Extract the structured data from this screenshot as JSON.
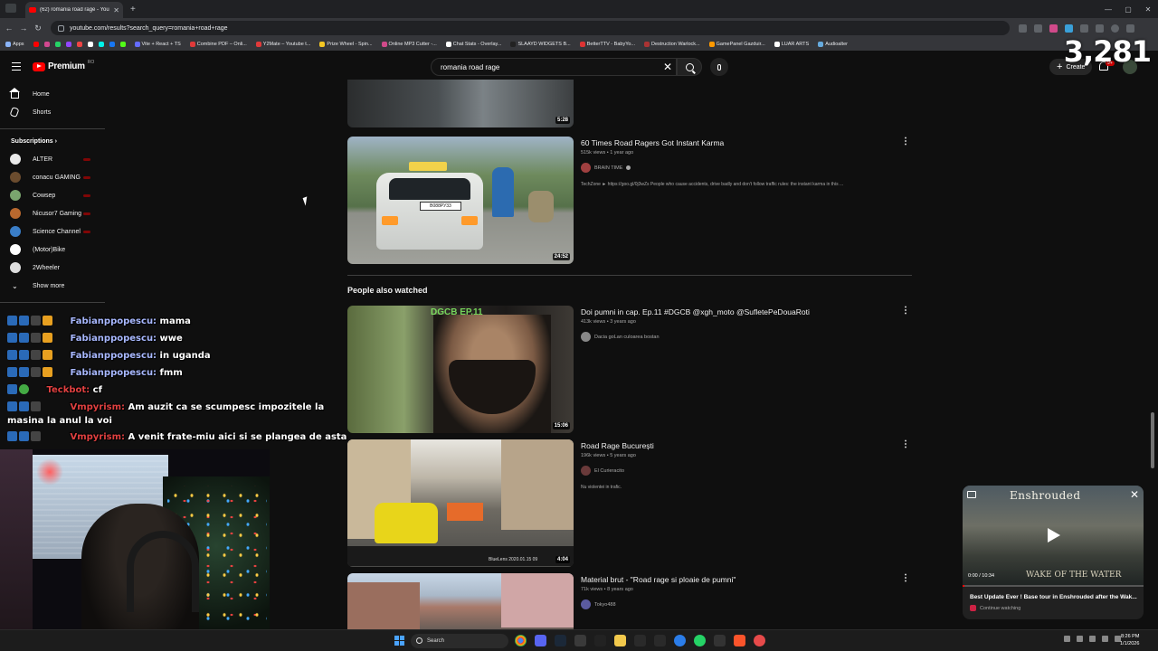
{
  "browser": {
    "tab_title": "(62) romania road rage - YouTube",
    "url": "youtube.com/results?search_query=romania+road+rage",
    "bookmarks": [
      "Apps",
      "Vite + React + TS",
      "Combine PDF – Onli...",
      "Y2Mate – Youtube t...",
      "Prize Wheel - Spin...",
      "Online MP3 Cutter -...",
      "Chat Stats - Overlay...",
      "SLAAYD WIDGETS B...",
      "BetterTTV - BabyYo...",
      "Destruction Warlock...",
      "GamePanel Gazduir...",
      "LUAR ARTS",
      "Audioalter"
    ]
  },
  "masthead": {
    "logo_text": "Premium",
    "country_code": "RO",
    "search_value": "romania road rage",
    "create_label": "Create",
    "notification_badge": "9+"
  },
  "overlay": {
    "viewer_count": "3,281"
  },
  "sidebar": {
    "home": "Home",
    "shorts": "Shorts",
    "subscriptions_heading": "Subscriptions",
    "subscriptions": [
      {
        "name": "ALTER",
        "color": "#e9e9e9"
      },
      {
        "name": "conacu GAMING",
        "color": "#6b4c2e"
      },
      {
        "name": "Cowsep",
        "color": "#7aa56e"
      },
      {
        "name": "Nicusor7 Gaming",
        "color": "#b8682e"
      },
      {
        "name": "Science Channel",
        "color": "#3a7ec8"
      },
      {
        "name": "(Motor)Bike",
        "color": "#ffffff"
      },
      {
        "name": "2Wheeler",
        "color": "#dddddd"
      }
    ],
    "show_more": "Show more"
  },
  "chat": [
    {
      "user": "Fabianppopescu:",
      "message": "mama"
    },
    {
      "user": "Fabianppopescu:",
      "message": "wwe"
    },
    {
      "user": "Fabianppopescu:",
      "message": "in uganda"
    },
    {
      "user": "Fabianppopescu:",
      "message": "fmm"
    },
    {
      "user": "Teckbot:",
      "message": "cf"
    },
    {
      "user": "Vmpyrism:",
      "message": "Am auzit ca se scumpesc impozitele la masina la anul la voi"
    },
    {
      "user": "Vmpyrism:",
      "message": "A venit frate-miu aici si se plangea de asta"
    }
  ],
  "results": [
    {
      "duration": "5:28"
    },
    {
      "title": "60 Times Road Ragers Got Instant Karma",
      "meta": "515k views • 1 year ago",
      "channel": "BRAIN TIME",
      "description": "TechZone ► https://goo.gl/0j3wZs People who cause accidents, drive badly and don't follow traffic rules: the instant karma in this ...",
      "duration": "24:52",
      "plate": "В088РУ33"
    }
  ],
  "section_title": "People also watched",
  "people_also_watched": [
    {
      "title": "Doi pumni in cap. Ep.11 #DGCB @xgh_moto @SufletePeDouaRoti",
      "meta": "413k views • 3 years ago",
      "channel": "Dacia goLan culoarea bostan",
      "duration": "15:06",
      "overlay_text": "DGCB EP.11"
    },
    {
      "title": "Road Rage București",
      "meta": "196k views • 5 years ago",
      "channel": "El Curieracito",
      "description": "Nu violentei in trafic.",
      "duration": "4:04",
      "stamp": "BlueLens 2020.01.15 09"
    },
    {
      "title": "Material brut - \"Road rage si ploaie de pumni\"",
      "meta": "71k views • 8 years ago",
      "channel": "Tokyo488"
    }
  ],
  "miniplayer": {
    "art_title": "Enshrouded",
    "art_subtitle": "WAKE OF THE WATER",
    "time": "0:00 / 10:34",
    "progress": 0.01,
    "video_title": "Best Update Ever ! Base tour in Enshrouded after the Wak...",
    "continue_label": "Continue watching"
  },
  "taskbar": {
    "search": "Search",
    "time": "8:26 PM",
    "date": "1/1/2026"
  }
}
